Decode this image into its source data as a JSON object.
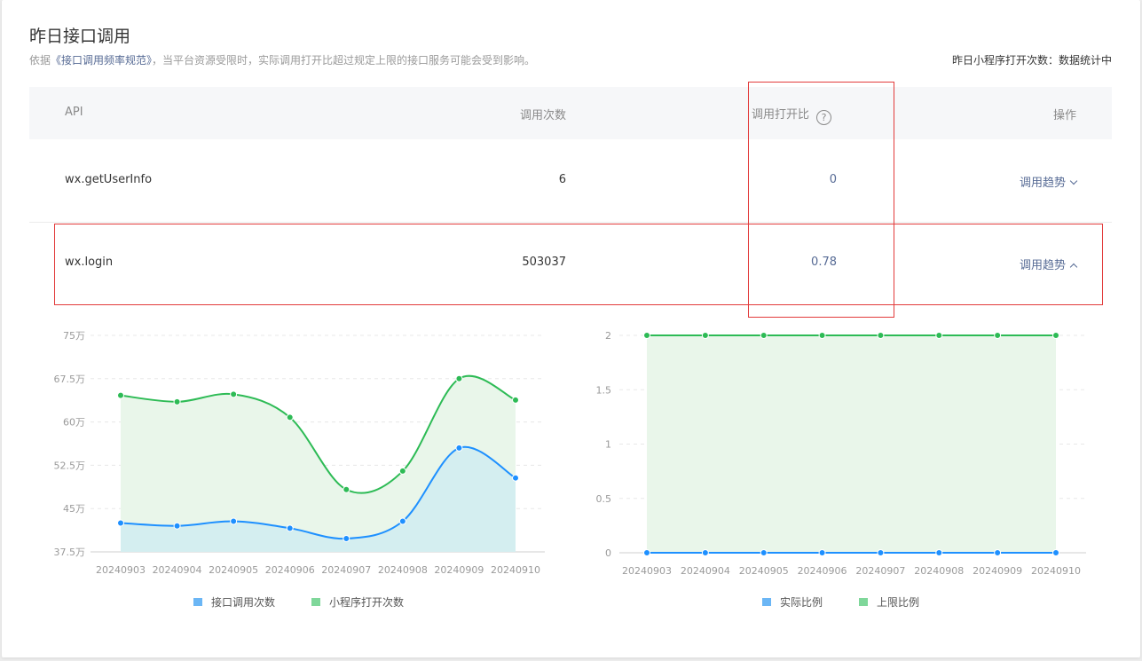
{
  "page": {
    "title": "昨日接口调用",
    "desc_prefix": "依据",
    "desc_link": "《接口调用频率规范》",
    "desc_suffix": "，当平台资源受限时，实际调用打开比超过规定上限的接口服务可能会受到影响。",
    "topright": "昨日小程序打开次数：数据统计中"
  },
  "table": {
    "headers": {
      "api": "API",
      "calls": "调用次数",
      "ratio": "调用打开比",
      "help": "?",
      "ops": "操作"
    },
    "rows": [
      {
        "api": "wx.getUserInfo",
        "calls": "6",
        "ratio": "0",
        "action": "调用趋势",
        "expanded": false
      },
      {
        "api": "wx.login",
        "calls": "503037",
        "ratio": "0.78",
        "action": "调用趋势",
        "expanded": true
      }
    ]
  },
  "colors": {
    "blue": "#1e90ff",
    "green": "#2dbb55",
    "link": "#576b95",
    "highlight": "#e23b3b"
  },
  "chart_data": [
    {
      "type": "area",
      "categories": [
        "20240903",
        "20240904",
        "20240905",
        "20240906",
        "20240907",
        "20240908",
        "20240909",
        "20240910"
      ],
      "y_ticks": [
        "37.5万",
        "45万",
        "52.5万",
        "60万",
        "67.5万",
        "75万"
      ],
      "ylim": [
        375000,
        750000
      ],
      "series": [
        {
          "name": "接口调用次数",
          "color": "#1e90ff",
          "values": [
            425000,
            420000,
            428000,
            416000,
            398000,
            428000,
            555000,
            503037
          ]
        },
        {
          "name": "小程序打开次数",
          "color": "#2dbb55",
          "values": [
            646000,
            635000,
            648000,
            608000,
            483000,
            515000,
            675000,
            638000
          ]
        }
      ],
      "grid": true,
      "legend_position": "bottom"
    },
    {
      "type": "area",
      "categories": [
        "20240903",
        "20240904",
        "20240905",
        "20240906",
        "20240907",
        "20240908",
        "20240909",
        "20240910"
      ],
      "y_ticks": [
        "0",
        "0.5",
        "1",
        "1.5",
        "2"
      ],
      "ylim": [
        0,
        2
      ],
      "series": [
        {
          "name": "实际比例",
          "color": "#1e90ff",
          "values": [
            0,
            0,
            0,
            0,
            0,
            0,
            0,
            0
          ]
        },
        {
          "name": "上限比例",
          "color": "#2dbb55",
          "values": [
            2,
            2,
            2,
            2,
            2,
            2,
            2,
            2
          ]
        }
      ],
      "grid": true,
      "legend_position": "bottom"
    }
  ]
}
